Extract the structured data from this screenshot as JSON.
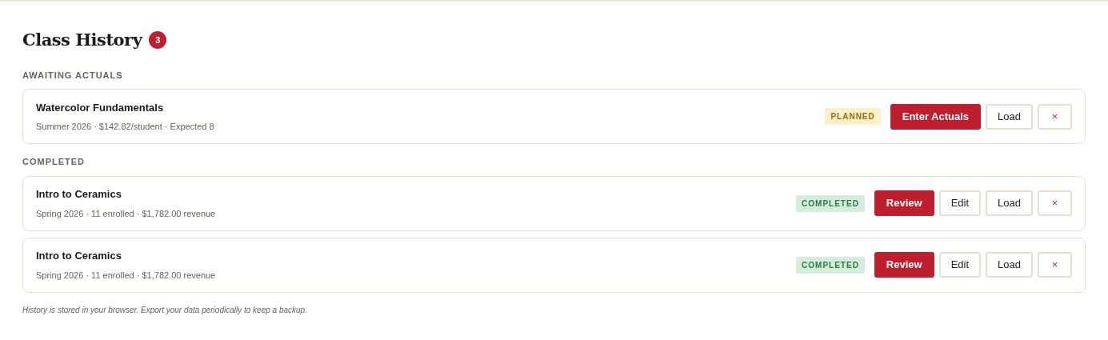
{
  "header": {
    "title": "Class History",
    "count": "3"
  },
  "sections": [
    {
      "label": "AWAITING ACTUALS",
      "classes": [
        {
          "name": "Watercolor Fundamentals",
          "details": "Summer 2026 · $142.82/student · Expected 8",
          "status": {
            "kind": "planned",
            "label": "PLANNED"
          },
          "actions": [
            {
              "kind": "primary",
              "label": "Enter Actuals"
            },
            {
              "kind": "secondary",
              "label": "Load"
            },
            {
              "kind": "delete",
              "label": "×"
            }
          ]
        }
      ]
    },
    {
      "label": "COMPLETED",
      "classes": [
        {
          "name": "Intro to Ceramics",
          "details": "Spring 2026 · 11 enrolled · $1,782.00 revenue",
          "status": {
            "kind": "completed",
            "label": "COMPLETED"
          },
          "actions": [
            {
              "kind": "primary",
              "label": "Review"
            },
            {
              "kind": "secondary",
              "label": "Edit"
            },
            {
              "kind": "secondary",
              "label": "Load"
            },
            {
              "kind": "delete",
              "label": "×"
            }
          ]
        },
        {
          "name": "Intro to Ceramics",
          "details": "Spring 2026 · 11 enrolled · $1,782.00 revenue",
          "status": {
            "kind": "completed",
            "label": "COMPLETED"
          },
          "actions": [
            {
              "kind": "primary",
              "label": "Review"
            },
            {
              "kind": "secondary",
              "label": "Edit"
            },
            {
              "kind": "secondary",
              "label": "Load"
            },
            {
              "kind": "delete",
              "label": "×"
            }
          ]
        }
      ]
    }
  ],
  "footer_note": "History is stored in your browser. Export your data periodically to keep a backup."
}
